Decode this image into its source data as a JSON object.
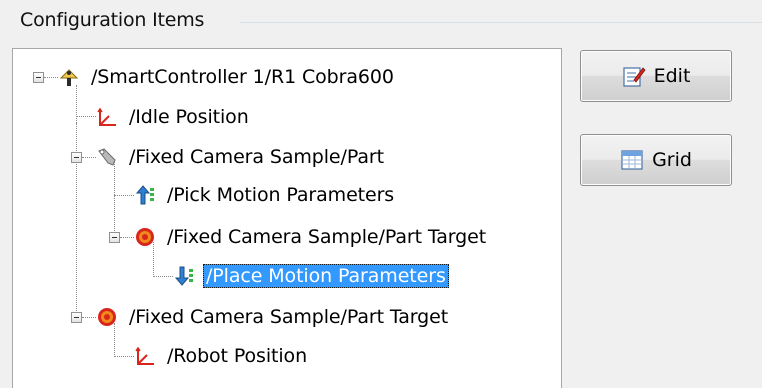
{
  "groupbox": {
    "title": "Configuration Items"
  },
  "tree": {
    "items": [
      {
        "label": "/SmartController 1/R1 Cobra600",
        "icon": "robot-arm-icon"
      },
      {
        "label": "/Idle Position",
        "icon": "position-axes-icon"
      },
      {
        "label": "/Fixed Camera Sample/Part",
        "icon": "wrench-part-icon"
      },
      {
        "label": "/Pick Motion Parameters",
        "icon": "pick-motion-icon"
      },
      {
        "label": "/Fixed Camera Sample/Part Target",
        "icon": "target-icon"
      },
      {
        "label": "/Place Motion Parameters",
        "icon": "place-motion-icon",
        "selected": true
      },
      {
        "label": "/Fixed Camera Sample/Part Target",
        "icon": "target-icon"
      },
      {
        "label": "/Robot Position",
        "icon": "position-axes-icon"
      }
    ]
  },
  "buttons": {
    "edit_label": "Edit",
    "grid_label": "Grid"
  },
  "colors": {
    "selection": "#3399ff",
    "accent_red": "#d9261c"
  }
}
